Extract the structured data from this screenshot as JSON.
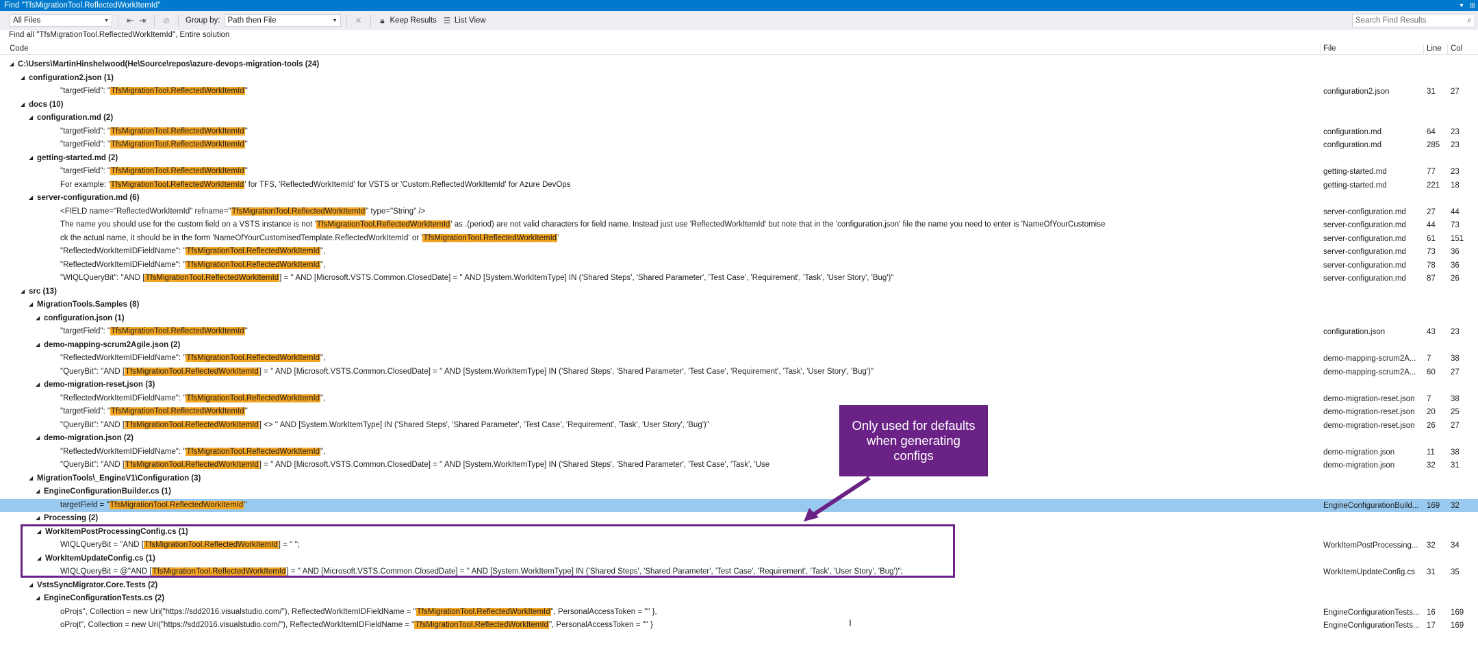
{
  "titlebar": {
    "title": "Find \"TfsMigrationTool.ReflectedWorkItemId\"",
    "pin_glyph": "▾",
    "dock_glyph": "⊞"
  },
  "toolbar": {
    "scope_value": "All Files",
    "group_by_label": "Group by:",
    "group_by_value": "Path then File",
    "keep_results_label": "Keep Results",
    "list_view_label": "List View",
    "search_placeholder": "Search Find Results"
  },
  "info_text": "Find all \"TfsMigrationTool.ReflectedWorkItemId\", Entire solution",
  "columns": {
    "code": "Code",
    "file": "File",
    "line": "Line",
    "col": "Col"
  },
  "highlight_term": "TfsMigrationTool.ReflectedWorkItemId",
  "rows": [
    {
      "level": 0,
      "group": true,
      "text": "C:\\Users\\MartinHinshelwood(He\\Source\\repos\\azure-devops-migration-tools (24)"
    },
    {
      "level": 1,
      "group": true,
      "text": "configuration2.json (1)"
    },
    {
      "level": 3,
      "pre": "\"targetField\": \"",
      "post": "\"",
      "file": "configuration2.json",
      "line": "31",
      "col": "27"
    },
    {
      "level": 1,
      "group": true,
      "text": "docs (10)"
    },
    {
      "level": 2,
      "group": true,
      "text": "configuration.md (2)"
    },
    {
      "level": 3,
      "pre": "\"targetField\": \"",
      "post": "\"",
      "file": "configuration.md",
      "line": "64",
      "col": "23"
    },
    {
      "level": 3,
      "pre": "\"targetField\": \"",
      "post": "\"",
      "file": "configuration.md",
      "line": "285",
      "col": "23"
    },
    {
      "level": 2,
      "group": true,
      "text": "getting-started.md (2)"
    },
    {
      "level": 3,
      "pre": "\"targetField\": \"",
      "post": "\"",
      "file": "getting-started.md",
      "line": "77",
      "col": "23"
    },
    {
      "level": 3,
      "pre": "For example: '",
      "post": "' for TFS, 'ReflectedWorkItemId' for VSTS or 'Custom.ReflectedWorkItemId' for Azure DevOps",
      "file": "getting-started.md",
      "line": "221",
      "col": "18"
    },
    {
      "level": 2,
      "group": true,
      "text": "server-configuration.md (6)"
    },
    {
      "level": 3,
      "pre": "<FIELD name=\"ReflectedWorkItemId\" refname=\"",
      "post": "\" type=\"String\" />",
      "file": "server-configuration.md",
      "line": "27",
      "col": "44"
    },
    {
      "level": 3,
      "pre": "The name you should use for the custom field on a VSTS instance is not '",
      "post": "' as .(period) are not valid characters for field name. Instead just use 'ReflectedWorkItemId' but note that in the 'configuration.json' file the name you need to enter is 'NameOfYourCustomise",
      "file": "server-configuration.md",
      "line": "44",
      "col": "73"
    },
    {
      "level": 3,
      "pre": "ck the actual name, it should be in the form 'NameOfYourCustomisedTemplate.ReflectedWorkItemId' or '",
      "post": "'",
      "file": "server-configuration.md",
      "line": "61",
      "col": "151"
    },
    {
      "level": 3,
      "pre": "\"ReflectedWorkItemIDFieldName\": \"",
      "post": "\",",
      "file": "server-configuration.md",
      "line": "73",
      "col": "36"
    },
    {
      "level": 3,
      "pre": "\"ReflectedWorkItemIDFieldName\": \"",
      "post": "\",",
      "file": "server-configuration.md",
      "line": "78",
      "col": "36"
    },
    {
      "level": 3,
      "pre": "\"WIQLQueryBit\": \"AND [",
      "post": "] = '' AND  [Microsoft.VSTS.Common.ClosedDate] = '' AND [System.WorkItemType] IN ('Shared Steps', 'Shared Parameter', 'Test Case', 'Requirement', 'Task', 'User Story', 'Bug')\"",
      "file": "server-configuration.md",
      "line": "87",
      "col": "26"
    },
    {
      "level": 1,
      "group": true,
      "text": "src (13)"
    },
    {
      "level": 2,
      "group": true,
      "text": "MigrationTools.Samples (8)"
    },
    {
      "level": 3,
      "group": true,
      "text": "configuration.json (1)"
    },
    {
      "level": 3,
      "pre": "\"targetField\": \"",
      "post": "\"",
      "file": "configuration.json",
      "line": "43",
      "col": "23"
    },
    {
      "level": 3,
      "group": true,
      "text": "demo-mapping-scrum2Agile.json (2)"
    },
    {
      "level": 3,
      "pre": "\"ReflectedWorkItemIDFieldName\": \"",
      "post": "\",",
      "file": "demo-mapping-scrum2A...",
      "line": "7",
      "col": "38"
    },
    {
      "level": 3,
      "pre": "\"QueryBit\": \"AND [",
      "post": "] = '' AND  [Microsoft.VSTS.Common.ClosedDate] = '' AND [System.WorkItemType] IN ('Shared Steps', 'Shared Parameter', 'Test Case', 'Requirement', 'Task', 'User Story', 'Bug')\"",
      "file": "demo-mapping-scrum2A...",
      "line": "60",
      "col": "27"
    },
    {
      "level": 3,
      "group": true,
      "text": "demo-migration-reset.json (3)"
    },
    {
      "level": 3,
      "pre": "\"ReflectedWorkItemIDFieldName\": \"",
      "post": "\",",
      "file": "demo-migration-reset.json",
      "line": "7",
      "col": "38"
    },
    {
      "level": 3,
      "pre": "\"targetField\": \"",
      "post": "\"",
      "file": "demo-migration-reset.json",
      "line": "20",
      "col": "25"
    },
    {
      "level": 3,
      "pre": "\"QueryBit\": \"AND [",
      "post": "] <> '' AND [System.WorkItemType] IN ('Shared Steps', 'Shared Parameter', 'Test Case', 'Requirement', 'Task', 'User Story', 'Bug')\"",
      "file": "demo-migration-reset.json",
      "line": "26",
      "col": "27"
    },
    {
      "level": 3,
      "group": true,
      "text": "demo-migration.json (2)"
    },
    {
      "level": 3,
      "pre": "\"ReflectedWorkItemIDFieldName\": \"",
      "post": "\",",
      "file": "demo-migration.json",
      "line": "11",
      "col": "38"
    },
    {
      "level": 3,
      "pre": "\"QueryBit\": \"AND [",
      "post": "] = '' AND  [Microsoft.VSTS.Common.ClosedDate] = '' AND [System.WorkItemType] IN ('Shared Steps', 'Shared Parameter', 'Test Case', 'Task', 'Use",
      "file": "demo-migration.json",
      "line": "32",
      "col": "31"
    },
    {
      "level": 2,
      "group": true,
      "text": "MigrationTools\\_EngineV1\\Configuration (3)"
    },
    {
      "level": 3,
      "group": true,
      "text": "EngineConfigurationBuilder.cs (1)"
    },
    {
      "level": 3,
      "selected": true,
      "pre": "targetField = \"",
      "post": "\"",
      "file": "EngineConfigurationBuild...",
      "line": "169",
      "col": "32"
    },
    {
      "level": 3,
      "group": true,
      "text": "Processing (2)"
    },
    {
      "level": 4,
      "group": true,
      "text": "WorkItemPostProcessingConfig.cs (1)"
    },
    {
      "level": 3,
      "pre": "WIQLQueryBit = \"AND [",
      "post": "] = '' \";",
      "file": "WorkItemPostProcessing...",
      "line": "32",
      "col": "34"
    },
    {
      "level": 4,
      "group": true,
      "text": "WorkItemUpdateConfig.cs (1)"
    },
    {
      "level": 3,
      "pre": "WIQLQueryBit = @\"AND [",
      "post": "] = '' AND  [Microsoft.VSTS.Common.ClosedDate] = '' AND [System.WorkItemType] IN ('Shared Steps', 'Shared Parameter', 'Test Case', 'Requirement', 'Task', 'User Story', 'Bug')\";",
      "file": "WorkItemUpdateConfig.cs",
      "line": "31",
      "col": "35"
    },
    {
      "level": 2,
      "group": true,
      "text": "VstsSyncMigrator.Core.Tests (2)"
    },
    {
      "level": 3,
      "group": true,
      "text": "EngineConfigurationTests.cs (2)"
    },
    {
      "level": 3,
      "pre": "oProjs\", Collection = new Uri(\"https://sdd2016.visualstudio.com/\"), ReflectedWorkItemIDFieldName = \"",
      "post": "\", PersonalAccessToken = \"\" },",
      "file": "EngineConfigurationTests...",
      "line": "16",
      "col": "169"
    },
    {
      "level": 3,
      "pre": "oProjt\", Collection = new Uri(\"https://sdd2016.visualstudio.com/\"), ReflectedWorkItemIDFieldName = \"",
      "post": "\", PersonalAccessToken = \"\" }",
      "file": "EngineConfigurationTests...",
      "line": "17",
      "col": "169"
    }
  ],
  "callout": {
    "text": "Only used for defaults when generating configs"
  },
  "colors": {
    "accent": "#007acc",
    "highlight": "#f5a623",
    "selection": "#99c9ef",
    "callout": "#6b2286"
  }
}
